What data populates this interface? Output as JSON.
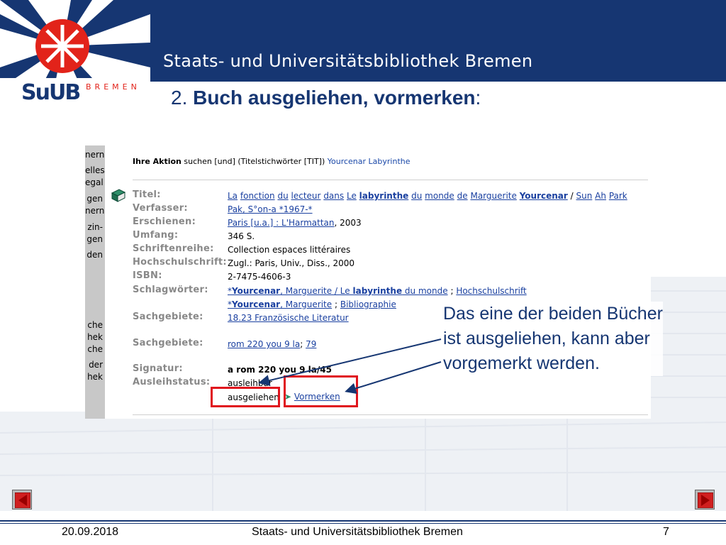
{
  "header": {
    "title": "Staats- und Universitätsbibliothek Bremen",
    "logo_text": "SuUB",
    "logo_bremen": "BREMEN"
  },
  "slide": {
    "number_prefix": "2. ",
    "title_bold": "Buch ausgeliehen, vormerken",
    "title_suffix": ":"
  },
  "screenshot": {
    "side_fragments": [
      "nern",
      "elles",
      "egal",
      "gen",
      "nern",
      "zin-",
      "gen",
      "den",
      "che",
      "hek",
      "che",
      "der",
      "hek"
    ],
    "action": {
      "label": "Ihre Aktion",
      "text": "suchen [und] (Titelstichwörter [TIT])",
      "query": "Yourcenar Labyrinthe"
    },
    "fields": {
      "titel": {
        "label": "Titel:"
      },
      "verfasser": {
        "label": "Verfasser:",
        "value": "Pak, S°on-a *1967-*"
      },
      "erschienen": {
        "label": "Erschienen:",
        "link": "Paris [u.a.] : L'Harmattan",
        "rest": ", 2003"
      },
      "umfang": {
        "label": "Umfang:",
        "value": "346 S."
      },
      "schriftenreihe": {
        "label": "Schriftenreihe:",
        "value": "Collection espaces littéraires"
      },
      "hochschulschrift": {
        "label": "Hochschulschrift:",
        "value": "Zugl.: Paris, Univ., Diss., 2000"
      },
      "isbn": {
        "label": "ISBN:",
        "value": "2-7475-4606-3"
      },
      "schlagwoerter": {
        "label": "Schlagwörter:"
      },
      "sachgebiete1": {
        "label": "Sachgebiete:",
        "value": "18.23 Französische Literatur"
      },
      "sachgebiete2": {
        "label": "Sachgebiete:",
        "link1": "rom 220 you 9 la",
        "sep": ";",
        "link2": "79"
      },
      "signatur": {
        "label": "Signatur:",
        "value": "a rom 220 you 9 la/45"
      },
      "ausleihstatus": {
        "label": "Ausleihstatus:",
        "value": "ausleihbar"
      }
    },
    "title_words": {
      "w1": "La",
      "w2": "fonction",
      "w3": "du",
      "w4": "lecteur",
      "w5": "dans",
      "w6": "Le",
      "w7": "labyrinthe",
      "w8": "du",
      "w9": "monde",
      "w10": "de",
      "w11": "Marguerite",
      "w12": "Yourcenar",
      "sep": "/",
      "w13": "Sun",
      "w14": "Ah",
      "w15": "Park"
    },
    "schlag": {
      "l1_star": "*",
      "l1_bold1": "Yourcenar",
      "l1_mid": ", Marguerite / Le ",
      "l1_bold2": "labyrinthe",
      "l1_end": " du monde",
      "l1_sep": ";",
      "l1_link2": "Hochschulschrift",
      "l2_star": "*",
      "l2_bold": "Yourcenar",
      "l2_end": ", Marguerite",
      "l2_sep": ";",
      "l2_link2": "Bibliographie"
    },
    "status_second": "ausgeliehen",
    "vormerken": "Vormerken"
  },
  "callout": {
    "text": "Das eine der beiden Bücher ist ausgeliehen, kann aber vorgemerkt werden."
  },
  "footer": {
    "date": "20.09.2018",
    "center": "Staats- und Universitätsbibliothek Bremen",
    "page": "7"
  },
  "colors": {
    "navy": "#163672",
    "red": "#e2231a",
    "link": "#1a40a0"
  }
}
